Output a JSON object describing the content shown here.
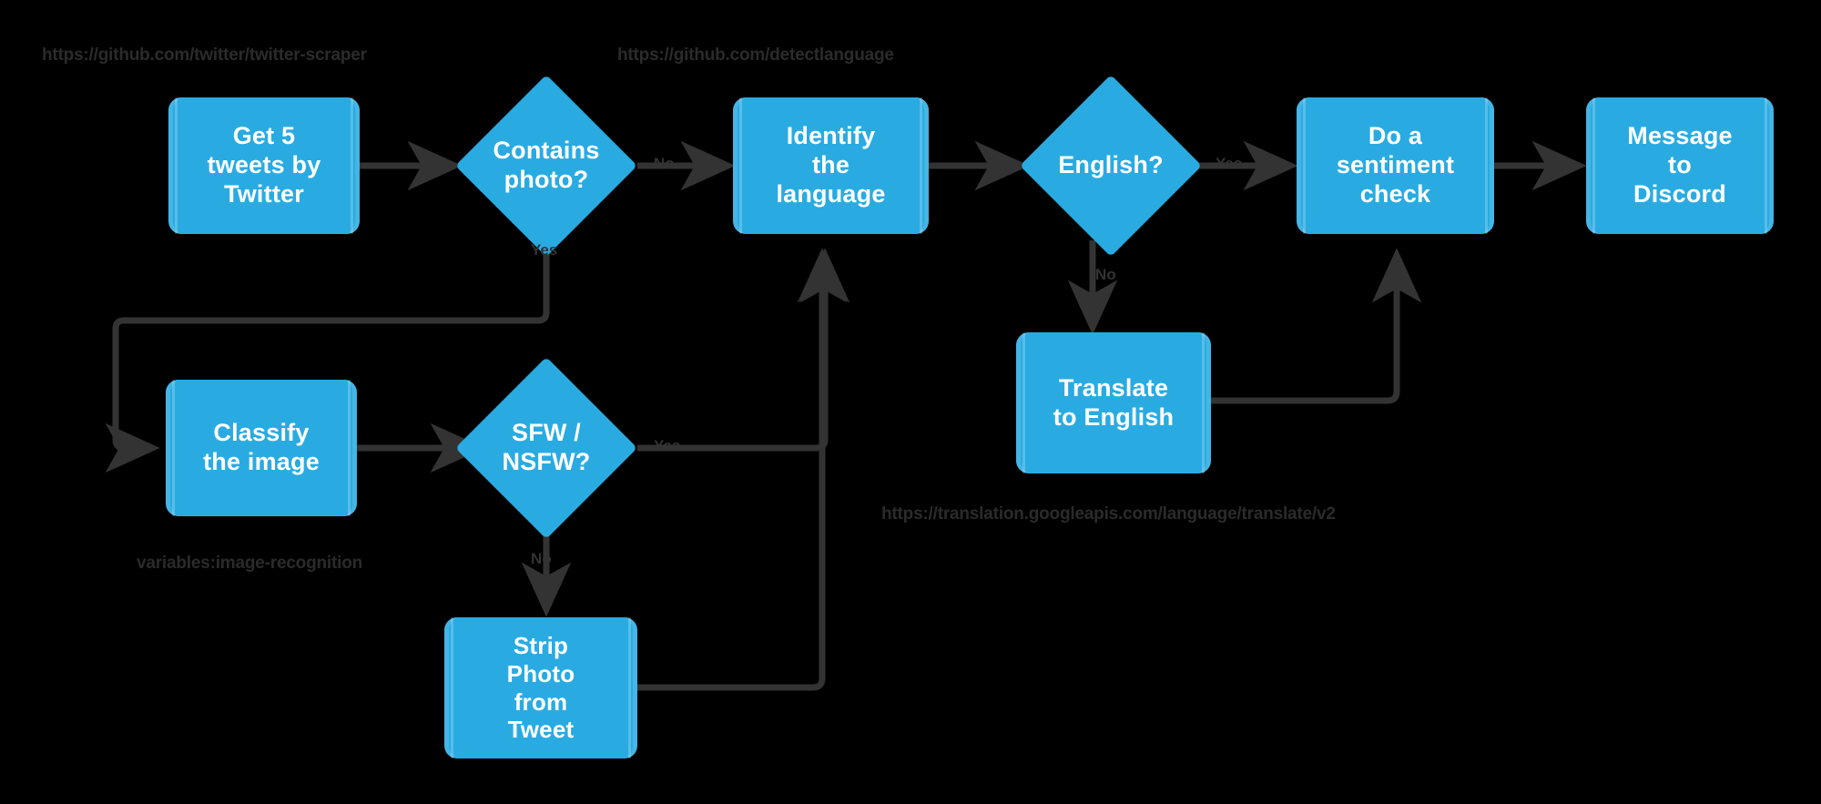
{
  "diagram": {
    "title": "Twitter tweet processing flowchart",
    "background_color": "#000000",
    "node_fill": "#29ABE2",
    "node_text_color": "#FFFFFF",
    "edge_color": "#333333",
    "caption_color": "#2b2b2b"
  },
  "nodes": [
    {
      "id": "get-tweets",
      "shape": "box",
      "label": "Get 5\ntweets by\nTwitter"
    },
    {
      "id": "contains-photo",
      "shape": "diamond",
      "label": "Contains\nphoto?"
    },
    {
      "id": "identify-language",
      "shape": "box",
      "label": "Identify\nthe\nlanguage"
    },
    {
      "id": "english",
      "shape": "diamond",
      "label": "English?"
    },
    {
      "id": "sentiment-check",
      "shape": "box",
      "label": "Do a\nsentiment\ncheck"
    },
    {
      "id": "message-discord",
      "shape": "box",
      "label": "Message\nto\nDiscord"
    },
    {
      "id": "classify-image",
      "shape": "box",
      "label": "Classify\nthe image"
    },
    {
      "id": "sfw-nsfw",
      "shape": "diamond",
      "label": "SFW /\nNSFW?"
    },
    {
      "id": "strip-photo",
      "shape": "box",
      "label": "Strip\nPhoto\nfrom\nTweet"
    },
    {
      "id": "translate",
      "shape": "box",
      "label": "Translate\nto English"
    }
  ],
  "edge_labels": {
    "contains_photo_no": "No",
    "contains_photo_yes": "Yes",
    "english_yes": "Yes",
    "english_no": "No",
    "sfw_yes": "Yes",
    "sfw_no": "No"
  },
  "captions": {
    "twitter_scraper_url": "https://github.com/twitter/twitter-scraper",
    "detect_language_url": "https://github.com/detectlanguage",
    "image_recognition_var": "variables:image-recognition",
    "google_translate_url": "https://translation.googleapis.com/language/translate/v2"
  }
}
